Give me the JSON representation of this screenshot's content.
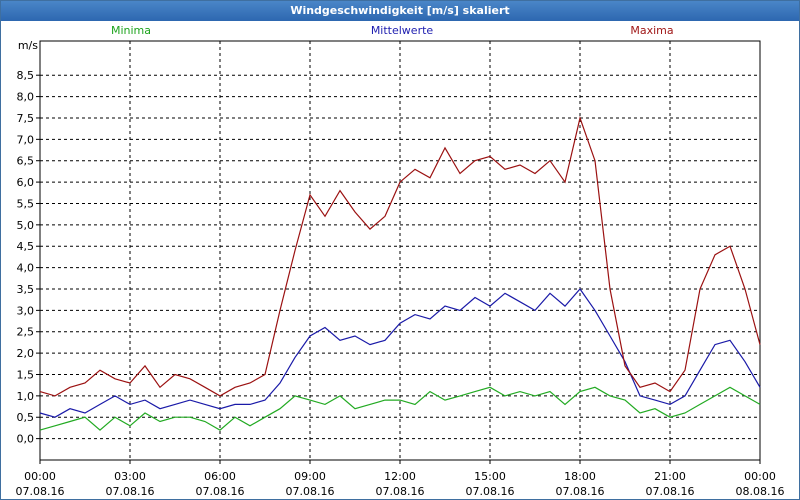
{
  "window": {
    "title": "Windgeschwindigkeit [m/s] skaliert"
  },
  "colors": {
    "minima": "#22aa22",
    "mittelwerte": "#1a1aa8",
    "maxima": "#9b1111",
    "grid": "#000000",
    "titlebar": "#2d67b0"
  },
  "chart_data": {
    "type": "line",
    "title": "Windgeschwindigkeit [m/s] skaliert",
    "ylabel": "m/s",
    "ylim": [
      -0.5,
      9.3
    ],
    "yticks": [
      "0,0",
      "0,5",
      "1,0",
      "1,5",
      "2,0",
      "2,5",
      "3,0",
      "3,5",
      "4,0",
      "4,5",
      "5,0",
      "5,5",
      "6,0",
      "6,5",
      "7,0",
      "7,5",
      "8,0",
      "8,5"
    ],
    "xlim_hours": [
      0,
      24
    ],
    "xticks": [
      {
        "time": "00:00",
        "date": "07.08.16"
      },
      {
        "time": "03:00",
        "date": "07.08.16"
      },
      {
        "time": "06:00",
        "date": "07.08.16"
      },
      {
        "time": "09:00",
        "date": "07.08.16"
      },
      {
        "time": "12:00",
        "date": "07.08.16"
      },
      {
        "time": "15:00",
        "date": "07.08.16"
      },
      {
        "time": "18:00",
        "date": "07.08.16"
      },
      {
        "time": "21:00",
        "date": "07.08.16"
      },
      {
        "time": "00:00",
        "date": "08.08.16"
      }
    ],
    "legend_placement": "top",
    "grid": true,
    "series": [
      {
        "name": "Minima",
        "color": "#22aa22",
        "points": [
          [
            0,
            0.2
          ],
          [
            0.5,
            0.3
          ],
          [
            1,
            0.4
          ],
          [
            1.5,
            0.5
          ],
          [
            2,
            0.2
          ],
          [
            2.5,
            0.5
          ],
          [
            3,
            0.3
          ],
          [
            3.5,
            0.6
          ],
          [
            4,
            0.4
          ],
          [
            4.5,
            0.5
          ],
          [
            5,
            0.5
          ],
          [
            5.5,
            0.4
          ],
          [
            6,
            0.2
          ],
          [
            6.5,
            0.5
          ],
          [
            7,
            0.3
          ],
          [
            7.5,
            0.5
          ],
          [
            8,
            0.7
          ],
          [
            8.5,
            1.0
          ],
          [
            9,
            0.9
          ],
          [
            9.5,
            0.8
          ],
          [
            10,
            1.0
          ],
          [
            10.5,
            0.7
          ],
          [
            11,
            0.8
          ],
          [
            11.5,
            0.9
          ],
          [
            12,
            0.9
          ],
          [
            12.5,
            0.8
          ],
          [
            13,
            1.1
          ],
          [
            13.5,
            0.9
          ],
          [
            14,
            1.0
          ],
          [
            14.5,
            1.1
          ],
          [
            15,
            1.2
          ],
          [
            15.5,
            1.0
          ],
          [
            16,
            1.1
          ],
          [
            16.5,
            1.0
          ],
          [
            17,
            1.1
          ],
          [
            17.5,
            0.8
          ],
          [
            18,
            1.1
          ],
          [
            18.5,
            1.2
          ],
          [
            19,
            1.0
          ],
          [
            19.5,
            0.9
          ],
          [
            20,
            0.6
          ],
          [
            20.5,
            0.7
          ],
          [
            21,
            0.5
          ],
          [
            21.5,
            0.6
          ],
          [
            22,
            0.8
          ],
          [
            22.5,
            1.0
          ],
          [
            23,
            1.2
          ],
          [
            23.5,
            1.0
          ],
          [
            24,
            0.8
          ]
        ]
      },
      {
        "name": "Mittelwerte",
        "color": "#1a1aa8",
        "points": [
          [
            0,
            0.6
          ],
          [
            0.5,
            0.5
          ],
          [
            1,
            0.7
          ],
          [
            1.5,
            0.6
          ],
          [
            2,
            0.8
          ],
          [
            2.5,
            1.0
          ],
          [
            3,
            0.8
          ],
          [
            3.5,
            0.9
          ],
          [
            4,
            0.7
          ],
          [
            4.5,
            0.8
          ],
          [
            5,
            0.9
          ],
          [
            5.5,
            0.8
          ],
          [
            6,
            0.7
          ],
          [
            6.5,
            0.8
          ],
          [
            7,
            0.8
          ],
          [
            7.5,
            0.9
          ],
          [
            8,
            1.3
          ],
          [
            8.5,
            1.9
          ],
          [
            9,
            2.4
          ],
          [
            9.5,
            2.6
          ],
          [
            10,
            2.3
          ],
          [
            10.5,
            2.4
          ],
          [
            11,
            2.2
          ],
          [
            11.5,
            2.3
          ],
          [
            12,
            2.7
          ],
          [
            12.5,
            2.9
          ],
          [
            13,
            2.8
          ],
          [
            13.5,
            3.1
          ],
          [
            14,
            3.0
          ],
          [
            14.5,
            3.3
          ],
          [
            15,
            3.1
          ],
          [
            15.5,
            3.4
          ],
          [
            16,
            3.2
          ],
          [
            16.5,
            3.0
          ],
          [
            17,
            3.4
          ],
          [
            17.5,
            3.1
          ],
          [
            18,
            3.5
          ],
          [
            18.5,
            3.0
          ],
          [
            19,
            2.4
          ],
          [
            19.5,
            1.8
          ],
          [
            20,
            1.0
          ],
          [
            20.5,
            0.9
          ],
          [
            21,
            0.8
          ],
          [
            21.5,
            1.0
          ],
          [
            22,
            1.6
          ],
          [
            22.5,
            2.2
          ],
          [
            23,
            2.3
          ],
          [
            23.5,
            1.8
          ],
          [
            24,
            1.2
          ]
        ]
      },
      {
        "name": "Maxima",
        "color": "#9b1111",
        "points": [
          [
            0,
            1.1
          ],
          [
            0.5,
            1.0
          ],
          [
            1,
            1.2
          ],
          [
            1.5,
            1.3
          ],
          [
            2,
            1.6
          ],
          [
            2.5,
            1.4
          ],
          [
            3,
            1.3
          ],
          [
            3.5,
            1.7
          ],
          [
            4,
            1.2
          ],
          [
            4.5,
            1.5
          ],
          [
            5,
            1.4
          ],
          [
            5.5,
            1.2
          ],
          [
            6,
            1.0
          ],
          [
            6.5,
            1.2
          ],
          [
            7,
            1.3
          ],
          [
            7.5,
            1.5
          ],
          [
            8,
            3.0
          ],
          [
            8.5,
            4.4
          ],
          [
            9,
            5.7
          ],
          [
            9.5,
            5.2
          ],
          [
            10,
            5.8
          ],
          [
            10.5,
            5.3
          ],
          [
            11,
            4.9
          ],
          [
            11.5,
            5.2
          ],
          [
            12,
            6.0
          ],
          [
            12.5,
            6.3
          ],
          [
            13,
            6.1
          ],
          [
            13.5,
            6.8
          ],
          [
            14,
            6.2
          ],
          [
            14.5,
            6.5
          ],
          [
            15,
            6.6
          ],
          [
            15.5,
            6.3
          ],
          [
            16,
            6.4
          ],
          [
            16.5,
            6.2
          ],
          [
            17,
            6.5
          ],
          [
            17.5,
            6.0
          ],
          [
            18,
            7.5
          ],
          [
            18.5,
            6.5
          ],
          [
            19,
            3.5
          ],
          [
            19.5,
            1.7
          ],
          [
            20,
            1.2
          ],
          [
            20.5,
            1.3
          ],
          [
            21,
            1.1
          ],
          [
            21.5,
            1.6
          ],
          [
            22,
            3.5
          ],
          [
            22.5,
            4.3
          ],
          [
            23,
            4.5
          ],
          [
            23.5,
            3.5
          ],
          [
            24,
            2.2
          ]
        ]
      }
    ]
  }
}
